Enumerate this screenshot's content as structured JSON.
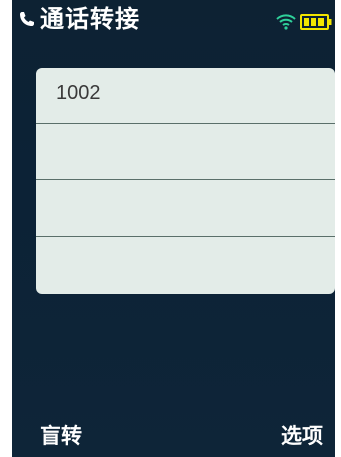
{
  "status_bar": {
    "title": "通话转接",
    "icons": [
      "phone-icon",
      "wifi-icon",
      "battery-icon"
    ],
    "accent_color": "#f2e600"
  },
  "list": {
    "rows": [
      {
        "value": "1002"
      },
      {
        "value": ""
      },
      {
        "value": ""
      },
      {
        "value": ""
      }
    ]
  },
  "softkeys": {
    "left": "盲转",
    "right": "选项"
  },
  "colors": {
    "background": "#0d2233",
    "panel": "#e3ece8",
    "divider": "#5a6f6a",
    "text_light": "#ffffff",
    "text_dark": "#3a3a3a"
  }
}
